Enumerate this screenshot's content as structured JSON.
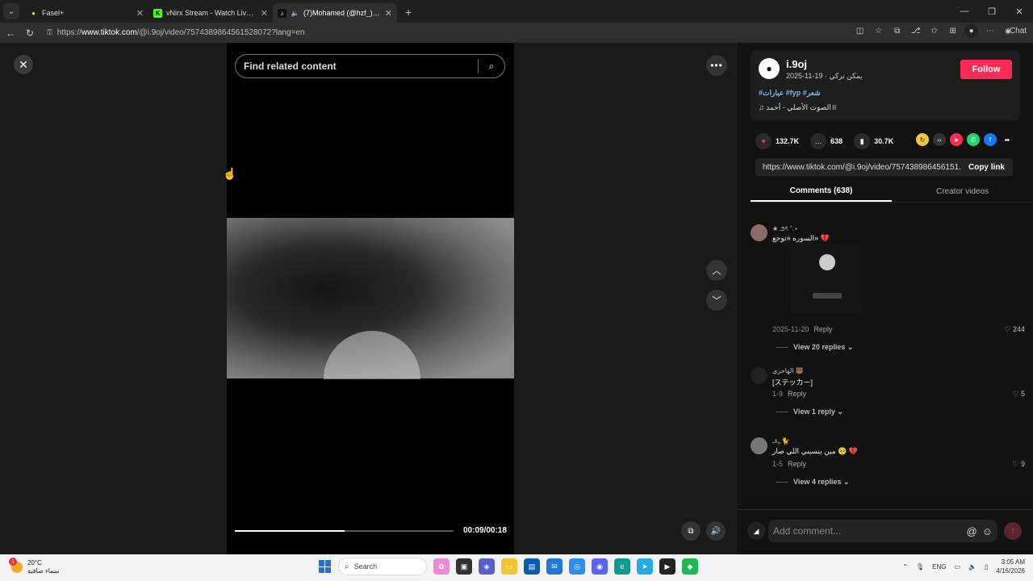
{
  "browser": {
    "tabs": [
      {
        "title": "Fasel+",
        "favicon": "bulb-icon",
        "color": "#f2c744"
      },
      {
        "title": "vNirx Stream - Watch Live on Kick",
        "favicon": "kick-icon",
        "color": "#53fc18"
      },
      {
        "title": "(7)Mohamed (@hzf_) | TikTok",
        "favicon": "tiktok-icon",
        "color": "#000000"
      }
    ],
    "url_prefix": "https://",
    "url_host": "www.tiktok.com",
    "url_path": "/@i.9oj/video/7574389864561528072?lang=en",
    "chat_label": "Chat"
  },
  "video": {
    "search_placeholder": "Find related content",
    "time": "00:09/00:18",
    "progress": 0.5
  },
  "author": {
    "username": "i.9oj",
    "meta": "2025-11-19 · يمكن تركي",
    "follow_label": "Follow",
    "tags": "#عبارات #fyp #شعر",
    "music": "♫ الصوت الأصلي - أحمد♕"
  },
  "stats": {
    "likes": "132.7K",
    "comments": "638",
    "saves": "30.7K"
  },
  "link": {
    "url": "https://www.tiktok.com/@i.9oj/video/757438986456151...",
    "copy_label": "Copy link"
  },
  "tabs": {
    "comments": "Comments (638)",
    "creator": "Creator videos"
  },
  "comments": [
    {
      "name": "★ ౨ৎ ˚.⋆",
      "text": "السوره «توجع» 💔",
      "date": "2025-11-20",
      "reply": "Reply",
      "likes": "244",
      "view_replies": "View 20 replies"
    },
    {
      "name": "الهاجري 🐻",
      "text": "[ステッカー]",
      "date": "1-9",
      "reply": "Reply",
      "likes": "5",
      "view_replies": "View 1 reply"
    },
    {
      "name": "ـﮩ٨ـ🐈",
      "text": "مين ينسيني اللي صار 🥺 💔",
      "date": "1-5",
      "reply": "Reply",
      "likes": "9",
      "view_replies": "View 4 replies"
    }
  ],
  "add_comment": {
    "placeholder": "Add comment..."
  },
  "taskbar": {
    "temp": "20°C",
    "weather": "سماء صافية",
    "notif_count": "1",
    "search": "Search",
    "lang": "ENG",
    "time": "3:05 AM",
    "date": "4/16/2026"
  }
}
